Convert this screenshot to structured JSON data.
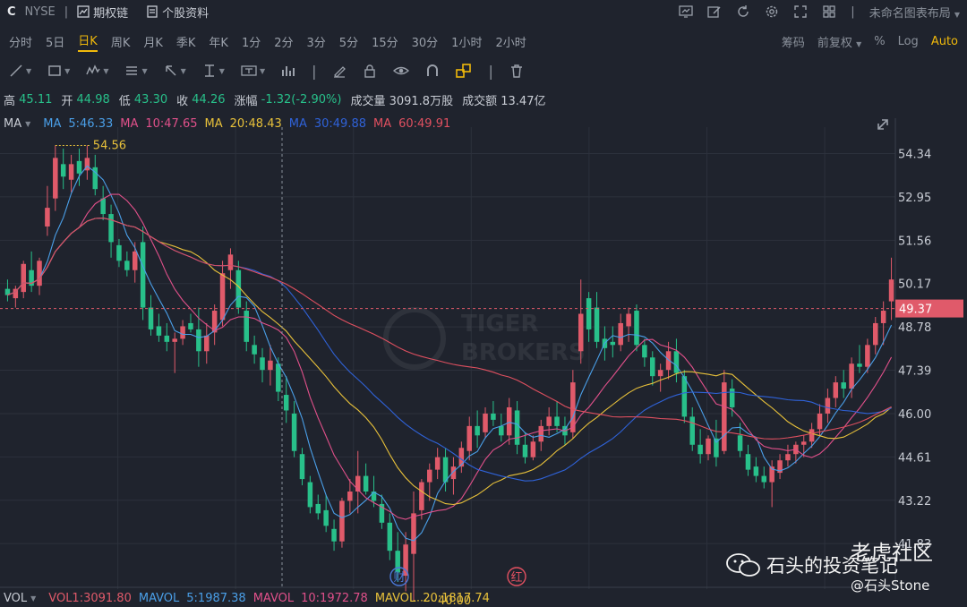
{
  "top": {
    "ticker": "C",
    "exchange": "NYSE",
    "options_label": "期权链",
    "profile_label": "个股资料",
    "layout_label": "未命名图表布局"
  },
  "timeframes": [
    "分时",
    "5日",
    "日K",
    "周K",
    "月K",
    "季K",
    "年K",
    "1分",
    "2分",
    "3分",
    "5分",
    "15分",
    "30分",
    "1小时",
    "2小时"
  ],
  "active_timeframe": 2,
  "right_controls": {
    "chips": "筹码",
    "adjust": "前复权",
    "pct": "%",
    "log": "Log",
    "auto": "Auto"
  },
  "quote": {
    "high_label": "高",
    "high": "45.11",
    "open_label": "开",
    "open": "44.98",
    "low_label": "低",
    "low": "43.30",
    "close_label": "收",
    "close": "44.26",
    "chg_label": "涨幅",
    "chg": "-1.32(-2.90%)",
    "vol_label": "成交量",
    "vol": "3091.8万股",
    "amt_label": "成交额",
    "amt": "13.47亿"
  },
  "ma_legend": {
    "label": "MA",
    "items": [
      {
        "text": "MA",
        "color": "#4a9fe8"
      },
      {
        "text": "5:46.33",
        "color": "#4a9fe8"
      },
      {
        "text": "MA",
        "color": "#e0508a"
      },
      {
        "text": "10:47.65",
        "color": "#e0508a"
      },
      {
        "text": "MA",
        "color": "#e8c13a"
      },
      {
        "text": "20:48.43",
        "color": "#e8c13a"
      },
      {
        "text": "MA",
        "color": "#2f62d8"
      },
      {
        "text": "30:49.88",
        "color": "#2f62d8"
      },
      {
        "text": "MA",
        "color": "#e05060"
      },
      {
        "text": "60:49.91",
        "color": "#e05060"
      }
    ]
  },
  "vol_legend": {
    "label": "VOL",
    "items": [
      {
        "text": "VOL1:3091.80",
        "color": "#e05a6a"
      },
      {
        "text": "MAVOL",
        "color": "#4a9fe8"
      },
      {
        "text": "5:1987.38",
        "color": "#4a9fe8"
      },
      {
        "text": "MAVOL",
        "color": "#e0508a"
      },
      {
        "text": "10:1972.78",
        "color": "#e0508a"
      },
      {
        "text": "MAVOL",
        "color": "#e8c13a"
      },
      {
        "text": "20:1817.74",
        "color": "#e8c13a"
      }
    ]
  },
  "watermark": {
    "line1": "TIGER",
    "line2": "BROKERS",
    "community": "老虎社区",
    "account": "石头的投资笔记",
    "handle": "@石头Stone"
  },
  "markers": {
    "cai": "财",
    "hong": "红"
  },
  "chart_data": {
    "type": "candlestick",
    "y_ticks": [
      54.34,
      52.95,
      51.56,
      50.17,
      48.78,
      47.39,
      46.0,
      44.61,
      43.22,
      41.83
    ],
    "ylim": [
      40.6,
      54.9
    ],
    "current_price": 49.37,
    "max_label": "54.56",
    "min_label": "40.00",
    "colors": {
      "up": "#e05a6a",
      "down": "#28c08a"
    },
    "ohlc": [
      [
        50.0,
        50.3,
        49.6,
        49.8
      ],
      [
        49.7,
        50.1,
        49.4,
        50.0
      ],
      [
        49.9,
        50.9,
        49.7,
        50.8
      ],
      [
        50.6,
        51.2,
        49.9,
        50.1
      ],
      [
        50.1,
        51.0,
        49.8,
        50.9
      ],
      [
        52.0,
        53.3,
        51.7,
        52.6
      ],
      [
        52.9,
        54.6,
        52.5,
        54.2
      ],
      [
        54.0,
        54.5,
        53.2,
        53.6
      ],
      [
        53.5,
        54.3,
        53.1,
        54.0
      ],
      [
        54.1,
        54.5,
        53.3,
        53.7
      ],
      [
        53.8,
        54.6,
        53.5,
        54.2
      ],
      [
        53.9,
        54.3,
        53.0,
        53.2
      ],
      [
        52.9,
        53.3,
        52.2,
        52.4
      ],
      [
        52.4,
        52.7,
        51.0,
        51.5
      ],
      [
        51.4,
        51.6,
        50.7,
        50.9
      ],
      [
        50.9,
        51.2,
        50.4,
        50.6
      ],
      [
        50.6,
        51.5,
        50.2,
        51.2
      ],
      [
        51.5,
        52.0,
        49.0,
        49.4
      ],
      [
        49.4,
        49.8,
        48.5,
        48.7
      ],
      [
        48.8,
        49.2,
        48.3,
        48.5
      ],
      [
        48.5,
        48.9,
        48.0,
        48.3
      ],
      [
        48.3,
        48.6,
        47.3,
        48.4
      ],
      [
        48.4,
        49.0,
        48.2,
        48.8
      ],
      [
        48.9,
        49.2,
        48.6,
        48.7
      ],
      [
        48.7,
        49.4,
        47.5,
        48.0
      ],
      [
        48.0,
        48.9,
        47.6,
        48.5
      ],
      [
        48.6,
        49.5,
        48.2,
        49.3
      ],
      [
        49.0,
        50.9,
        48.8,
        50.5
      ],
      [
        50.6,
        51.3,
        50.0,
        51.1
      ],
      [
        50.6,
        50.9,
        49.2,
        49.4
      ],
      [
        49.3,
        49.6,
        48.0,
        48.3
      ],
      [
        48.2,
        48.5,
        47.6,
        47.9
      ],
      [
        47.8,
        48.1,
        47.0,
        47.4
      ],
      [
        47.4,
        48.2,
        46.9,
        47.7
      ],
      [
        47.6,
        47.8,
        46.4,
        46.7
      ],
      [
        46.6,
        47.2,
        45.7,
        46.1
      ],
      [
        46.0,
        46.4,
        44.6,
        44.8
      ],
      [
        44.7,
        44.9,
        43.7,
        43.9
      ],
      [
        43.8,
        44.0,
        42.8,
        43.0
      ],
      [
        43.1,
        43.4,
        42.6,
        42.8
      ],
      [
        42.9,
        43.4,
        42.2,
        42.4
      ],
      [
        42.3,
        42.6,
        41.6,
        41.9
      ],
      [
        41.9,
        43.3,
        41.7,
        43.2
      ],
      [
        43.2,
        43.9,
        42.8,
        43.5
      ],
      [
        43.5,
        44.8,
        42.8,
        44.0
      ],
      [
        44.0,
        44.4,
        43.4,
        43.5
      ],
      [
        43.5,
        44.0,
        43.0,
        43.2
      ],
      [
        43.1,
        43.4,
        42.3,
        42.5
      ],
      [
        42.5,
        42.8,
        41.3,
        41.6
      ],
      [
        41.6,
        42.2,
        40.6,
        40.9
      ],
      [
        40.8,
        42.2,
        40.3,
        41.8
      ],
      [
        41.5,
        43.5,
        40.0,
        42.8
      ],
      [
        42.9,
        43.9,
        42.6,
        43.8
      ],
      [
        43.8,
        44.4,
        43.2,
        44.2
      ],
      [
        44.2,
        44.9,
        43.9,
        44.6
      ],
      [
        44.6,
        44.9,
        43.5,
        43.8
      ],
      [
        43.9,
        44.6,
        43.4,
        44.3
      ],
      [
        44.3,
        45.1,
        44.1,
        44.9
      ],
      [
        44.8,
        45.9,
        44.5,
        45.6
      ],
      [
        45.6,
        46.1,
        44.9,
        45.3
      ],
      [
        45.4,
        46.2,
        45.2,
        46.0
      ],
      [
        46.0,
        46.4,
        45.6,
        45.8
      ],
      [
        45.6,
        46.0,
        45.1,
        45.3
      ],
      [
        45.3,
        46.5,
        45.0,
        46.2
      ],
      [
        46.1,
        46.4,
        44.7,
        45.0
      ],
      [
        45.0,
        45.4,
        44.4,
        44.6
      ],
      [
        44.6,
        45.3,
        44.5,
        45.1
      ],
      [
        45.1,
        45.8,
        44.8,
        45.6
      ],
      [
        45.6,
        46.2,
        45.3,
        45.9
      ],
      [
        45.9,
        46.4,
        45.4,
        45.6
      ],
      [
        45.6,
        45.9,
        45.0,
        45.3
      ],
      [
        45.4,
        47.4,
        45.2,
        47.0
      ],
      [
        48.0,
        50.3,
        47.6,
        49.2
      ],
      [
        49.7,
        49.9,
        48.3,
        48.7
      ],
      [
        49.4,
        49.9,
        48.1,
        48.3
      ],
      [
        48.4,
        48.8,
        47.7,
        48.1
      ],
      [
        48.3,
        48.8,
        47.8,
        48.2
      ],
      [
        48.2,
        49.2,
        48.0,
        48.9
      ],
      [
        48.8,
        49.4,
        48.3,
        49.2
      ],
      [
        49.3,
        49.5,
        48.0,
        48.2
      ],
      [
        48.2,
        48.4,
        47.5,
        47.8
      ],
      [
        47.8,
        48.0,
        46.9,
        47.2
      ],
      [
        47.2,
        47.6,
        46.7,
        47.4
      ],
      [
        47.4,
        48.3,
        47.1,
        48.0
      ],
      [
        48.0,
        48.4,
        47.0,
        47.3
      ],
      [
        47.2,
        47.4,
        45.7,
        45.9
      ],
      [
        45.9,
        46.2,
        44.8,
        45.0
      ],
      [
        45.0,
        45.5,
        44.4,
        44.7
      ],
      [
        44.7,
        45.3,
        44.5,
        45.2
      ],
      [
        45.2,
        45.8,
        44.3,
        44.6
      ],
      [
        44.8,
        47.4,
        44.7,
        47.0
      ],
      [
        46.8,
        47.1,
        45.9,
        46.2
      ],
      [
        45.3,
        45.7,
        44.6,
        44.8
      ],
      [
        44.7,
        45.0,
        44.0,
        44.2
      ],
      [
        44.3,
        44.6,
        43.8,
        44.0
      ],
      [
        44.0,
        44.3,
        43.6,
        43.8
      ],
      [
        43.8,
        44.5,
        43.0,
        44.3
      ],
      [
        44.1,
        44.7,
        43.9,
        44.5
      ],
      [
        44.5,
        45.0,
        44.3,
        44.7
      ],
      [
        44.7,
        45.1,
        44.4,
        45.0
      ],
      [
        45.0,
        45.3,
        44.6,
        45.1
      ],
      [
        45.1,
        45.7,
        44.9,
        45.5
      ],
      [
        45.5,
        46.3,
        45.3,
        46.0
      ],
      [
        46.0,
        46.8,
        45.7,
        46.5
      ],
      [
        46.5,
        47.2,
        46.2,
        47.0
      ],
      [
        47.0,
        47.4,
        46.5,
        46.8
      ],
      [
        46.8,
        47.8,
        46.5,
        47.6
      ],
      [
        47.6,
        48.2,
        47.3,
        47.5
      ],
      [
        47.5,
        48.4,
        47.3,
        48.2
      ],
      [
        48.2,
        49.1,
        47.9,
        48.9
      ],
      [
        48.9,
        49.6,
        48.2,
        49.3
      ],
      [
        49.6,
        51.0,
        49.0,
        50.3
      ]
    ]
  }
}
